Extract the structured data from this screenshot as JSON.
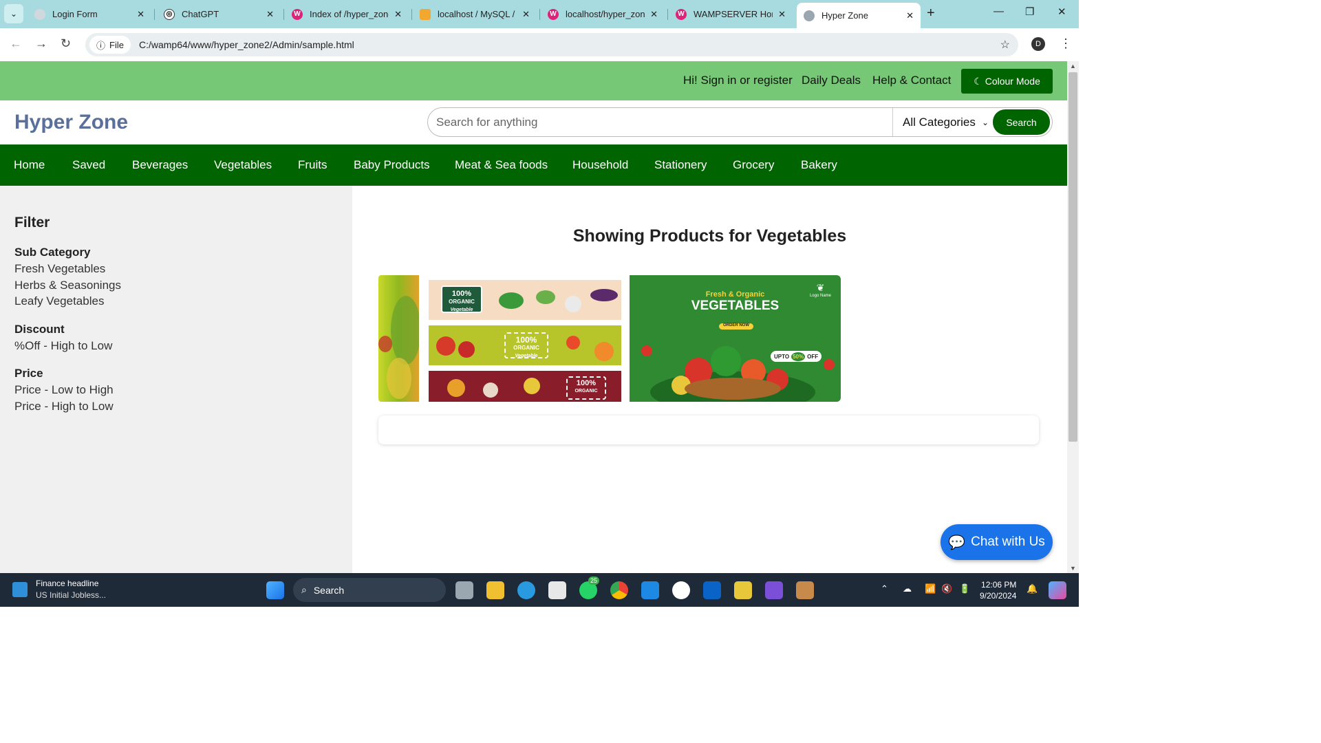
{
  "browser": {
    "tabs": [
      {
        "title": "Login Form",
        "favicon_color": "#d0d8dc"
      },
      {
        "title": "ChatGPT",
        "favicon_color": "#ffffff"
      },
      {
        "title": "Index of /hyper_zone",
        "favicon_color": "#e0237a"
      },
      {
        "title": "localhost / MySQL / h",
        "favicon_color": "#f0a830"
      },
      {
        "title": "localhost/hyper_zone",
        "favicon_color": "#e0237a"
      },
      {
        "title": "WAMPSERVER Home",
        "favicon_color": "#e0237a"
      },
      {
        "title": "Hyper Zone",
        "favicon_color": "#9aa6b0"
      }
    ],
    "active_tab_index": 6,
    "url_chip": "File",
    "url": "C:/wamp64/www/hyper_zone2/Admin/sample.html",
    "profile_initial": "D"
  },
  "site": {
    "topbar_links": [
      "Hi! Sign in or register",
      "Daily Deals",
      "Help & Contact"
    ],
    "colour_mode_label": "Colour Mode",
    "logo": "Hyper Zone",
    "search_placeholder": "Search for anything",
    "category_select": "All Categories",
    "search_button": "Search",
    "categories": [
      "Home",
      "Saved",
      "Beverages",
      "Vegetables",
      "Fruits",
      "Baby Products",
      "Meat & Sea foods",
      "Household",
      "Stationery",
      "Grocery",
      "Bakery"
    ]
  },
  "filter": {
    "title": "Filter",
    "groups": [
      {
        "title": "Sub Category",
        "options": [
          "Fresh Vegetables",
          "Herbs & Seasonings",
          "Leafy Vegetables"
        ]
      },
      {
        "title": "Discount",
        "options": [
          "%Off - High to Low"
        ]
      },
      {
        "title": "Price",
        "options": [
          "Price - Low to High",
          "Price - High to Low"
        ]
      }
    ]
  },
  "main": {
    "heading": "Showing Products for Vegetables",
    "banners": {
      "organic_badge": "100%",
      "organic_text": "ORGANIC",
      "organic_sub": "Vegetable",
      "promo_small": "Fresh & Organic",
      "promo_big": "VEGETABLES",
      "promo_cta": "ORDER NOW",
      "promo_upto": "UPTO",
      "promo_pct": "50%",
      "promo_off": "OFF",
      "promo_logo": "Logo Name"
    }
  },
  "chat_button": "Chat with Us",
  "taskbar": {
    "news_title": "Finance headline",
    "news_sub": "US Initial Jobless...",
    "search_label": "Search",
    "whatsapp_badge": "25",
    "time": "12:06 PM",
    "date": "9/20/2024"
  }
}
